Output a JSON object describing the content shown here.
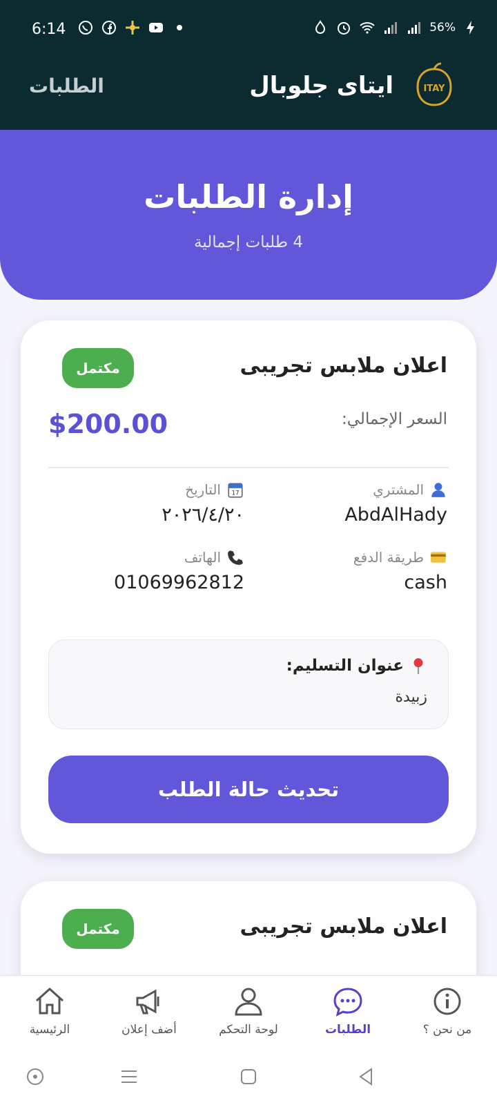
{
  "status_bar": {
    "time": "6:14",
    "battery": "56%",
    "notification_icons": [
      "whatsapp-icon",
      "facebook-icon",
      "app-icon",
      "youtube-icon",
      "dot-icon"
    ],
    "system_icons": [
      "vpn-icon",
      "alarm-icon",
      "wifi-icon",
      "signal-icon",
      "signal-icon",
      "battery-icon"
    ]
  },
  "app_bar": {
    "title": "ايتاى جلوبال",
    "page_label": "الطلبات",
    "logo_text": "ITAY"
  },
  "hero": {
    "title": "إدارة الطلبات",
    "subtitle": "4 طلبات إجمالية"
  },
  "orders": [
    {
      "product_name": "اعلان ملابس تجريبى",
      "status": "مكتمل",
      "total_label": "السعر الإجمالي:",
      "total_value": "$200.00",
      "buyer_label": "المشتري",
      "buyer": "AbdAlHady",
      "date_label": "التاريخ",
      "date": "٢٠٢٦/٤/٢٠",
      "payment_label": "طريقة الدفع",
      "payment": "cash",
      "phone_label": "الهاتف",
      "phone": "01069962812",
      "address_label": "عنوان التسليم:",
      "address": "زبيدة",
      "update_button": "تحديث حالة الطلب"
    },
    {
      "product_name": "اعلان ملابس تجريبى",
      "status": "مكتمل"
    }
  ],
  "bottom_nav": [
    {
      "label": "من نحن ؟",
      "icon": "info-icon"
    },
    {
      "label": "الطلبات",
      "icon": "chat-icon",
      "active": true
    },
    {
      "label": "لوحة التحكم",
      "icon": "user-icon"
    },
    {
      "label": "أضف إعلان",
      "icon": "megaphone-icon"
    },
    {
      "label": "الرئيسية",
      "icon": "home-icon"
    }
  ],
  "colors": {
    "header": "#0c2b30",
    "primary": "#6257d9",
    "success": "#4cae4f",
    "price": "#5b51d8",
    "active_nav": "#5b3fc7"
  }
}
